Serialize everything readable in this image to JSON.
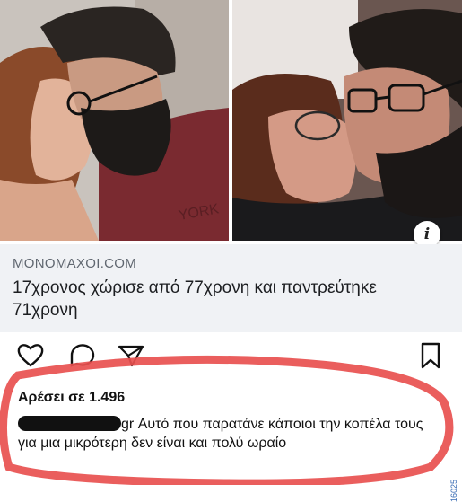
{
  "link_preview": {
    "domain": "MONOMAXOI.COM",
    "title": "17χρονος χώρισε από 77χρονη και παντρεύτηκε 71χρονη"
  },
  "photos": {
    "left_shirt_text": "YORK"
  },
  "info_badge": {
    "glyph": "i",
    "icon": "info-icon"
  },
  "actions": {
    "icons": [
      "heart-icon",
      "comment-icon",
      "send-icon",
      "bookmark-icon"
    ]
  },
  "likes": {
    "text": "Αρέσει σε 1.496"
  },
  "comment": {
    "username_suffix": "gr",
    "text": "Αυτό που παρατάνε κάποιοι την κοπέλα τους για μια μικρότερη δεν είναι και πολύ ωραίο"
  },
  "watermark": {
    "text": "16025"
  },
  "colors": {
    "highlight_ring": "#e8504f",
    "card_bg": "#f0f2f5",
    "domain_text": "#606770"
  }
}
